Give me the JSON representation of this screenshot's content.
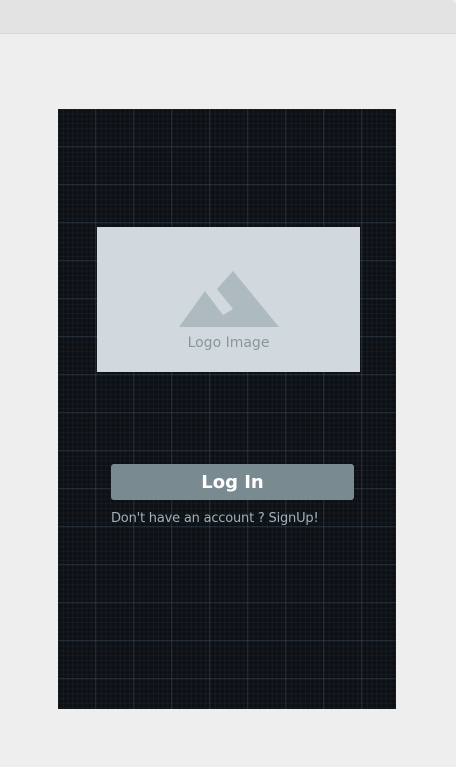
{
  "login_screen": {
    "logo": {
      "label": "Logo Image",
      "icon": "mountain-image-placeholder-icon"
    },
    "login_button": {
      "label": "Log In"
    },
    "signup_link": {
      "label": "Don't have an account ? SignUp!"
    }
  },
  "colors": {
    "canvas_background": "#eeeeee",
    "artboard_background": "#0d1014",
    "logo_placeholder": "#d1d9de",
    "logo_icon": "#adbac0",
    "button_background": "#7a8a91",
    "button_text": "#ffffff",
    "link_text": "#a3b0b7"
  }
}
